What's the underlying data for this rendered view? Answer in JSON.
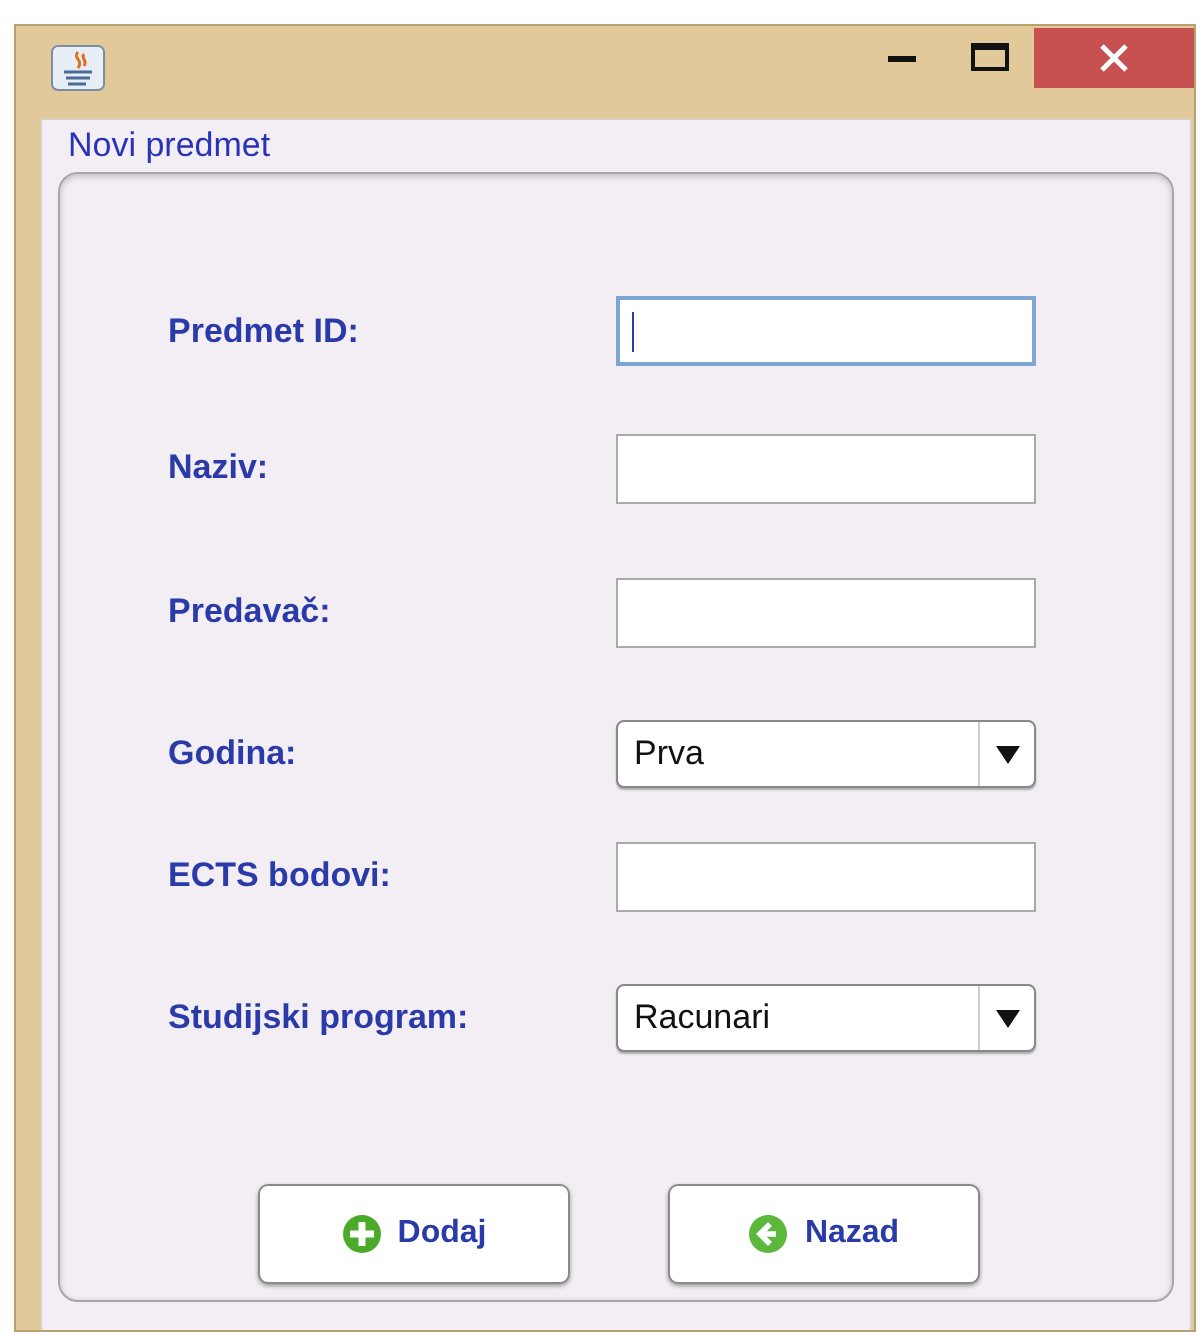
{
  "window": {
    "title": "Novi predmet"
  },
  "form": [
    {
      "kind": "text",
      "label": "Predmet ID:",
      "focused": true
    },
    {
      "kind": "text",
      "label": "Naziv:",
      "focused": false
    },
    {
      "kind": "text",
      "label": "Predavač:",
      "focused": false
    },
    {
      "kind": "combo",
      "label": "Godina:",
      "value": "Prva"
    },
    {
      "kind": "text",
      "label": "ECTS bodovi:",
      "focused": false
    },
    {
      "kind": "combo",
      "label": "Studijski program:",
      "value": "Racunari"
    }
  ],
  "buttons": [
    {
      "kind": "add",
      "label": "Dodaj"
    },
    {
      "kind": "back",
      "label": "Nazad"
    }
  ]
}
